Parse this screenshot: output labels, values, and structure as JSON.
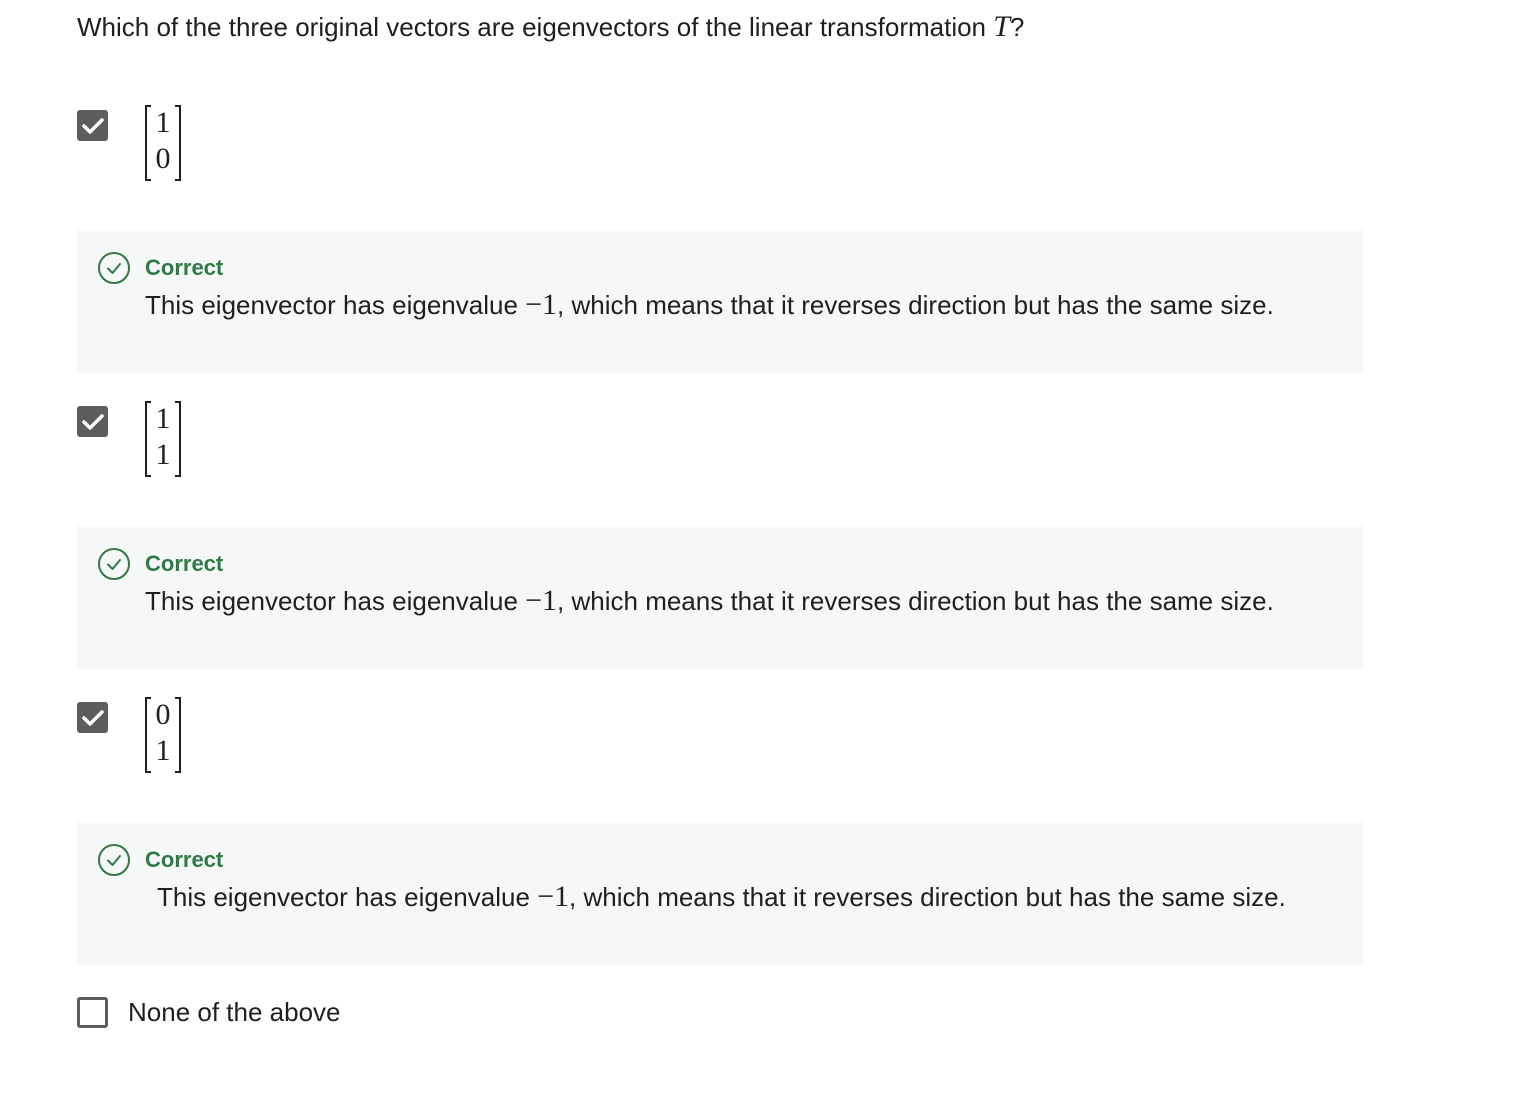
{
  "question": {
    "text_before": "Which of the three original vectors are eigenvectors of the linear transformation ",
    "variable": "T",
    "text_after": "?"
  },
  "options": [
    {
      "checked": true,
      "vector": [
        "1",
        "0"
      ],
      "feedback": {
        "status": "Correct",
        "text_before": "This eigenvector has eigenvalue ",
        "eigenvalue": "−1",
        "text_after": ", which means that it reverses direction but has the same size."
      }
    },
    {
      "checked": true,
      "vector": [
        "1",
        "1"
      ],
      "feedback": {
        "status": "Correct",
        "text_before": "This eigenvector has eigenvalue ",
        "eigenvalue": "−1",
        "text_after": ", which means that it reverses direction but has the same size."
      }
    },
    {
      "checked": true,
      "vector": [
        "0",
        "1"
      ],
      "feedback": {
        "status": "Correct",
        "text_before": "This eigenvector has eigenvalue ",
        "eigenvalue": "−1",
        "text_after": ", which means that it reverses direction but has the same size."
      }
    }
  ],
  "none_option": {
    "checked": false,
    "label": "None of the above"
  },
  "colors": {
    "correct_green": "#2f7a45",
    "checkbox_gray": "#5d5d5d",
    "feedback_bg": "#f6f8f7"
  },
  "icons": {
    "checkbox_checked": "checkmark-icon",
    "feedback_status": "check-circle-icon"
  }
}
